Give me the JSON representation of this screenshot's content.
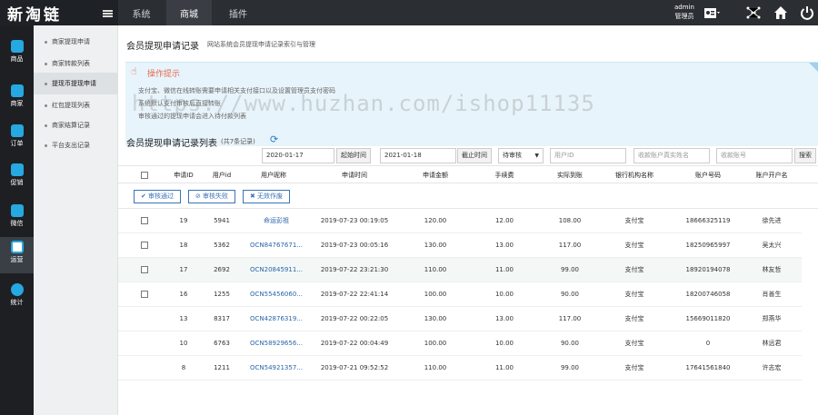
{
  "app": {
    "logo": "新淘链",
    "user_name": "admin",
    "user_role": "管理员"
  },
  "topnav": [
    "系统",
    "商城",
    "插件"
  ],
  "sidebar": [
    {
      "label": "商品",
      "icon": "goods-icon"
    },
    {
      "label": "商家",
      "icon": "shop-icon"
    },
    {
      "label": "订单",
      "icon": "order-icon"
    },
    {
      "label": "促销",
      "icon": "promo-icon"
    },
    {
      "label": "微信",
      "icon": "wechat-icon"
    },
    {
      "label": "运营",
      "icon": "operation-icon"
    },
    {
      "label": "统计",
      "icon": "stats-icon"
    }
  ],
  "submenu": [
    "商家提现申请",
    "商家转款列表",
    "提现币提现申请",
    "红包提现列表",
    "商家结算记录",
    "平台支出记录"
  ],
  "page": {
    "title": "会员提现申请记录",
    "subtitle": "网站系统会员提现申请记录索引与管理"
  },
  "tips": {
    "title": "操作提示",
    "lines": [
      "支付宝、微信在线转账需要申请相关支付接口以及设置管理员支付密码",
      "系统默认支付审核后直接转账",
      "审核通过的提现申请会进入待付款列表"
    ]
  },
  "list": {
    "title": "会员提现申请记录列表",
    "count": "(共7条记录)"
  },
  "filters": {
    "start_date": "2020-01-17",
    "start_label": "起始时间",
    "end_date": "2021-01-18",
    "end_label": "截止时间",
    "status": "待审核",
    "user_id_placeholder": "用户ID",
    "account_name_placeholder": "收款账户真实姓名",
    "account_no_placeholder": "收款账号",
    "search": "搜索"
  },
  "columns": [
    "申请ID",
    "用户id",
    "用户昵称",
    "申请时间",
    "申请金额",
    "手续费",
    "实际到账",
    "银行机构名称",
    "账户号码",
    "账户开户名"
  ],
  "actions": {
    "approve": "审核通过",
    "reject": "审核失败",
    "invalid": "无效作废"
  },
  "rows": [
    {
      "id": "19",
      "uid": "5941",
      "nick": "命运彭祖",
      "time": "2019-07-23 00:19:05",
      "amount": "120.00",
      "fee": "12.00",
      "actual": "108.00",
      "bank": "支付宝",
      "account": "18666325119",
      "holder": "徐先进",
      "check": true,
      "highlight": false
    },
    {
      "id": "18",
      "uid": "5362",
      "nick": "OCN84767671...",
      "time": "2019-07-23 00:05:16",
      "amount": "130.00",
      "fee": "13.00",
      "actual": "117.00",
      "bank": "支付宝",
      "account": "18250965997",
      "holder": "吴太兴",
      "check": true,
      "highlight": false
    },
    {
      "id": "17",
      "uid": "2692",
      "nick": "OCN20845911...",
      "time": "2019-07-22 23:21:30",
      "amount": "110.00",
      "fee": "11.00",
      "actual": "99.00",
      "bank": "支付宝",
      "account": "18920194078",
      "holder": "林友哲",
      "check": true,
      "highlight": true
    },
    {
      "id": "16",
      "uid": "1255",
      "nick": "OCN55456060...",
      "time": "2019-07-22 22:41:14",
      "amount": "100.00",
      "fee": "10.00",
      "actual": "90.00",
      "bank": "支付宝",
      "account": "18200746058",
      "holder": "肖善生",
      "check": true,
      "highlight": false
    },
    {
      "id": "13",
      "uid": "8317",
      "nick": "OCN42876319...",
      "time": "2019-07-22 00:22:05",
      "amount": "130.00",
      "fee": "13.00",
      "actual": "117.00",
      "bank": "支付宝",
      "account": "15669011820",
      "holder": "郑燕华",
      "check": false,
      "highlight": false
    },
    {
      "id": "10",
      "uid": "6763",
      "nick": "OCN58929656...",
      "time": "2019-07-22 00:04:49",
      "amount": "100.00",
      "fee": "10.00",
      "actual": "90.00",
      "bank": "支付宝",
      "account": "0",
      "holder": "林远君",
      "check": false,
      "highlight": false
    },
    {
      "id": "8",
      "uid": "1211",
      "nick": "OCN54921357...",
      "time": "2019-07-21 09:52:52",
      "amount": "110.00",
      "fee": "11.00",
      "actual": "99.00",
      "bank": "支付宝",
      "account": "17641561840",
      "holder": "许志宏",
      "check": false,
      "highlight": false
    }
  ],
  "watermark": "https://www.huzhan.com/ishop11135"
}
